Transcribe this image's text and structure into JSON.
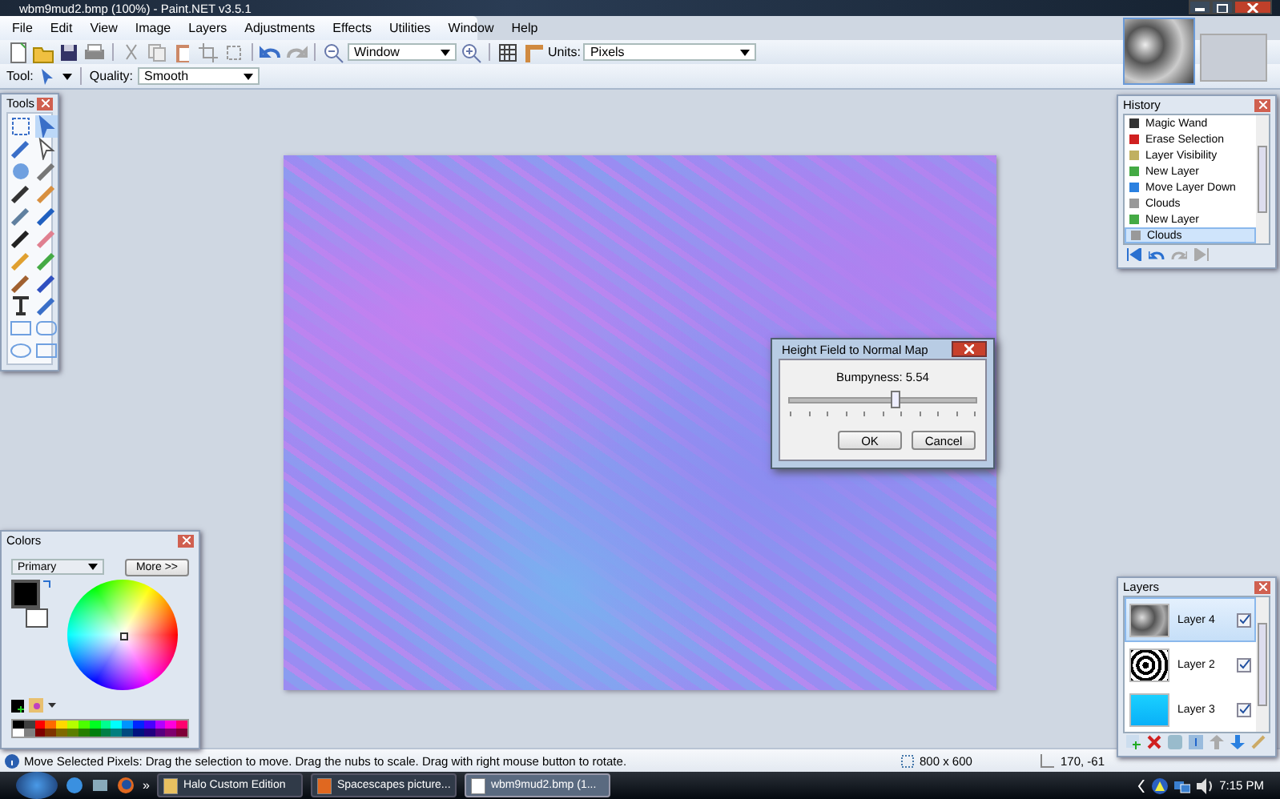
{
  "window": {
    "title": "wbm9mud2.bmp (100%) - Paint.NET v3.5.1"
  },
  "menu": [
    "File",
    "Edit",
    "View",
    "Image",
    "Layers",
    "Adjustments",
    "Effects",
    "Utilities",
    "Window",
    "Help"
  ],
  "toolbar": {
    "zoom": "Window",
    "units_label": "Units:",
    "units": "Pixels",
    "tool_label": "Tool:",
    "quality_label": "Quality:",
    "quality": "Smooth"
  },
  "tools_panel": {
    "title": "Tools"
  },
  "history": {
    "title": "History",
    "items": [
      {
        "label": "Magic Wand",
        "selected": false
      },
      {
        "label": "Erase Selection",
        "selected": false
      },
      {
        "label": "Layer Visibility",
        "selected": false
      },
      {
        "label": "New Layer",
        "selected": false
      },
      {
        "label": "Move Layer Down",
        "selected": false
      },
      {
        "label": "Clouds",
        "selected": false
      },
      {
        "label": "New Layer",
        "selected": false
      },
      {
        "label": "Clouds",
        "selected": true
      }
    ]
  },
  "dialog": {
    "title": "Height Field to Normal Map",
    "label": "Bumpyness: 5.54",
    "level": 0.57,
    "buttons": [
      "OK",
      "Cancel"
    ]
  },
  "colors": {
    "title": "Colors",
    "mode": "Primary",
    "more_button": "More >>",
    "primary": {
      "color": "#000000"
    },
    "secondary": {
      "color": "#ffffff"
    },
    "palette": [
      {
        "color": "#000000"
      },
      {
        "color": "#404040"
      },
      {
        "color": "#ff0000"
      },
      {
        "color": "#ff6a00"
      },
      {
        "color": "#ffd800"
      },
      {
        "color": "#b6ff00"
      },
      {
        "color": "#4cff00"
      },
      {
        "color": "#00ff21"
      },
      {
        "color": "#00ff90"
      },
      {
        "color": "#00ffff"
      },
      {
        "color": "#0094ff"
      },
      {
        "color": "#0026ff"
      },
      {
        "color": "#4800ff"
      },
      {
        "color": "#b200ff"
      },
      {
        "color": "#ff00dc"
      },
      {
        "color": "#ff006e"
      },
      {
        "color": "#ffffff"
      },
      {
        "color": "#808080"
      },
      {
        "color": "#7f0000"
      },
      {
        "color": "#7f3300"
      },
      {
        "color": "#7f6a00"
      },
      {
        "color": "#5b7f00"
      },
      {
        "color": "#267f00"
      },
      {
        "color": "#007f0e"
      },
      {
        "color": "#007f46"
      },
      {
        "color": "#007f7f"
      },
      {
        "color": "#004a7f"
      },
      {
        "color": "#00137f"
      },
      {
        "color": "#21007f"
      },
      {
        "color": "#57007f"
      },
      {
        "color": "#7f006e"
      },
      {
        "color": "#7f0037"
      }
    ]
  },
  "layers": {
    "title": "Layers",
    "items": [
      {
        "name": "Layer 4",
        "kind": "noise",
        "visible": true,
        "selected": true
      },
      {
        "name": "Layer 2",
        "kind": "blotch",
        "visible": true,
        "selected": false
      },
      {
        "name": "Layer 3",
        "kind": "fill",
        "visible": true,
        "selected": false
      }
    ]
  },
  "status_bar": {
    "message": "Move Selected Pixels: Drag the selection to move. Drag the nubs to scale. Drag with right mouse button to rotate.",
    "size": "800 x 600",
    "position": "170, -61"
  },
  "taskbar": {
    "chevron": "»",
    "items": [
      {
        "label": "Halo Custom Edition",
        "selected": false
      },
      {
        "label": "Spacescapes picture...",
        "selected": false
      },
      {
        "label": "wbm9mud2.bmp (1...",
        "selected": true
      }
    ],
    "clock": "7:15 PM"
  }
}
